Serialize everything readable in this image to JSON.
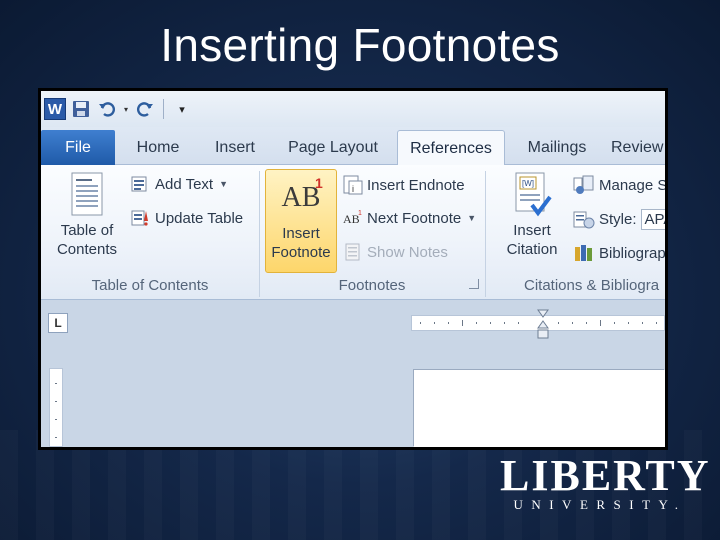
{
  "slide": {
    "title": "Inserting Footnotes",
    "logo": {
      "main": "LIBERTY",
      "sub": "UNIVERSITY."
    }
  },
  "word": {
    "qat": {
      "app_icon": "W",
      "icons": [
        "save-icon",
        "undo-icon",
        "redo-icon",
        "customize-qat-icon"
      ]
    },
    "tabs": [
      {
        "label": "File"
      },
      {
        "label": "Home"
      },
      {
        "label": "Insert"
      },
      {
        "label": "Page Layout"
      },
      {
        "label": "References",
        "active": true
      },
      {
        "label": "Mailings"
      },
      {
        "label": "Review"
      }
    ],
    "groups": {
      "toc": {
        "label": "Table of Contents",
        "table_of_contents": "Table of Contents",
        "add_text": "Add Text",
        "update_table": "Update Table"
      },
      "footnotes": {
        "label": "Footnotes",
        "insert_footnote": "Insert Footnote",
        "insert_endnote": "Insert Endnote",
        "next_footnote": "Next Footnote",
        "show_notes": "Show Notes",
        "ab_glyph": "AB",
        "superscript": "1"
      },
      "citations": {
        "label": "Citations & Bibliogra",
        "insert_citation": "Insert Citation",
        "manage_sources": "Manage S",
        "style_label": "Style:",
        "style_value": "APA",
        "bibliography": "Bibliograp"
      }
    },
    "ruler": {
      "tab_stop_glyph": "L"
    }
  },
  "colors": {
    "background": "#14284a",
    "file_tab": "#2a66b8",
    "highlight": "#fdd66b",
    "ribbon": "#f6f9fd"
  }
}
